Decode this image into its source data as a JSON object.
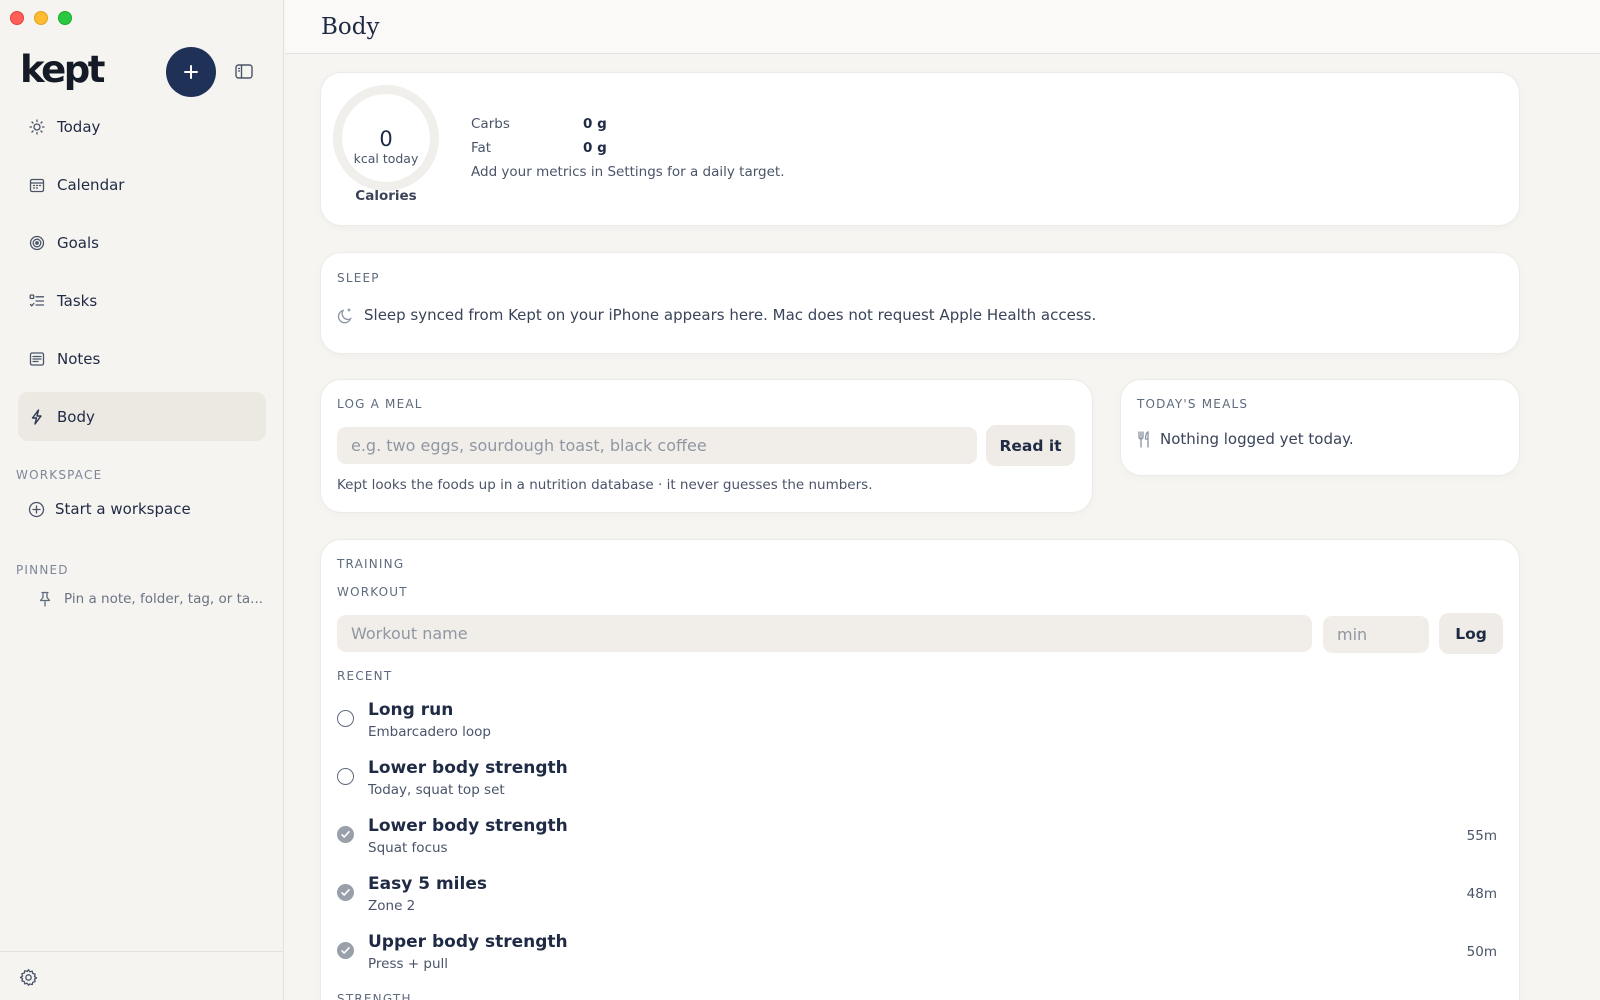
{
  "sidebar": {
    "logo": "kept",
    "items": [
      {
        "label": "Today",
        "icon": "sun-icon"
      },
      {
        "label": "Calendar",
        "icon": "calendar-icon"
      },
      {
        "label": "Goals",
        "icon": "target-icon"
      },
      {
        "label": "Tasks",
        "icon": "tasks-icon"
      },
      {
        "label": "Notes",
        "icon": "notes-icon"
      },
      {
        "label": "Body",
        "icon": "bolt-icon",
        "active": true
      }
    ],
    "workspace_label": "WORKSPACE",
    "start_workspace": "Start a workspace",
    "pinned_label": "PINNED",
    "pinned_placeholder": "Pin a note, folder, tag, or ta..."
  },
  "header": {
    "title": "Body"
  },
  "calories": {
    "value": "0",
    "unit": "kcal today",
    "label": "Calories",
    "carbs_label": "Carbs",
    "carbs_value": "0 g",
    "fat_label": "Fat",
    "fat_value": "0 g",
    "hint": "Add your metrics in Settings for a daily target."
  },
  "sleep": {
    "caption": "SLEEP",
    "message": "Sleep synced from Kept on your iPhone appears here. Mac does not request Apple Health access."
  },
  "log_meal": {
    "caption": "LOG A MEAL",
    "placeholder": "e.g. two eggs, sourdough toast, black coffee",
    "button": "Read it",
    "note": "Kept looks the foods up in a nutrition database · it never guesses the numbers."
  },
  "todays_meals": {
    "caption": "TODAY'S MEALS",
    "empty": "Nothing logged yet today."
  },
  "training": {
    "caption": "TRAINING",
    "workout_caption": "WORKOUT",
    "name_placeholder": "Workout name",
    "min_placeholder": "min",
    "log_button": "Log",
    "recent_caption": "RECENT",
    "recent": [
      {
        "name": "Long run",
        "sub": "Embarcadero loop",
        "done": false,
        "duration": ""
      },
      {
        "name": "Lower body strength",
        "sub": "Today, squat top set",
        "done": false,
        "duration": ""
      },
      {
        "name": "Lower body strength",
        "sub": "Squat focus",
        "done": true,
        "duration": "55m"
      },
      {
        "name": "Easy 5 miles",
        "sub": "Zone 2",
        "done": true,
        "duration": "48m"
      },
      {
        "name": "Upper body strength",
        "sub": "Press + pull",
        "done": true,
        "duration": "50m"
      }
    ],
    "next_caption": "STRENGTH"
  },
  "colors": {
    "accent": "#1f3156",
    "active_bg": "#ece8e2",
    "done_check": "#98a0aa"
  }
}
